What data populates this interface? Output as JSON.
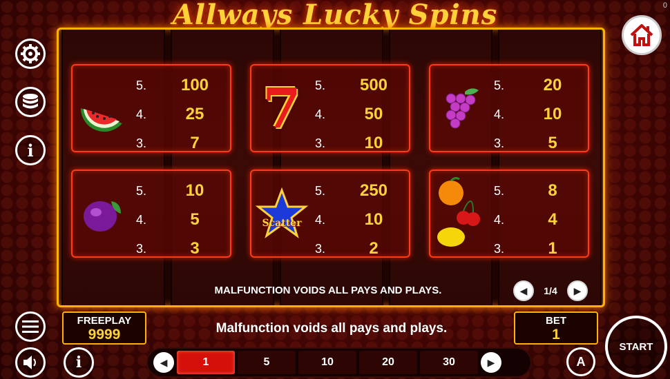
{
  "title": "Allways Lucky Spins",
  "top_counter": "0",
  "paytable": [
    {
      "symbol": "watermelon",
      "pays": [
        {
          "count": "5.",
          "value": "100"
        },
        {
          "count": "4.",
          "value": "25"
        },
        {
          "count": "3.",
          "value": "7"
        }
      ]
    },
    {
      "symbol": "seven",
      "symbol_text": "7",
      "pays": [
        {
          "count": "5.",
          "value": "500"
        },
        {
          "count": "4.",
          "value": "50"
        },
        {
          "count": "3.",
          "value": "10"
        }
      ]
    },
    {
      "symbol": "grapes",
      "pays": [
        {
          "count": "5.",
          "value": "20"
        },
        {
          "count": "4.",
          "value": "10"
        },
        {
          "count": "3.",
          "value": "5"
        }
      ]
    },
    {
      "symbol": "plum",
      "pays": [
        {
          "count": "5.",
          "value": "10"
        },
        {
          "count": "4.",
          "value": "5"
        },
        {
          "count": "3.",
          "value": "3"
        }
      ]
    },
    {
      "symbol": "scatter-star",
      "symbol_text": "Scatter",
      "pays": [
        {
          "count": "5.",
          "value": "250"
        },
        {
          "count": "4.",
          "value": "10"
        },
        {
          "count": "3.",
          "value": "2"
        }
      ]
    },
    {
      "symbol": "orange-cherries-lemon",
      "pays": [
        {
          "count": "5.",
          "value": "8"
        },
        {
          "count": "4.",
          "value": "4"
        },
        {
          "count": "3.",
          "value": "1"
        }
      ]
    }
  ],
  "board_note": "MALFUNCTION VOIDS ALL PAYS AND PLAYS.",
  "pager": {
    "text": "1/4"
  },
  "freeplay": {
    "label": "FREEPLAY",
    "value": "9999"
  },
  "message": "Malfunction voids all pays and plays.",
  "bet": {
    "label": "BET",
    "value": "1"
  },
  "bet_options": [
    "1",
    "5",
    "10",
    "20",
    "30"
  ],
  "bet_selected": "1",
  "start_label": "START",
  "auto_label": "A",
  "colors": {
    "gold": "#ffd23a",
    "frame": "#ffb300",
    "card_border": "#ff3a1a",
    "active_bet": "#d5100a"
  }
}
